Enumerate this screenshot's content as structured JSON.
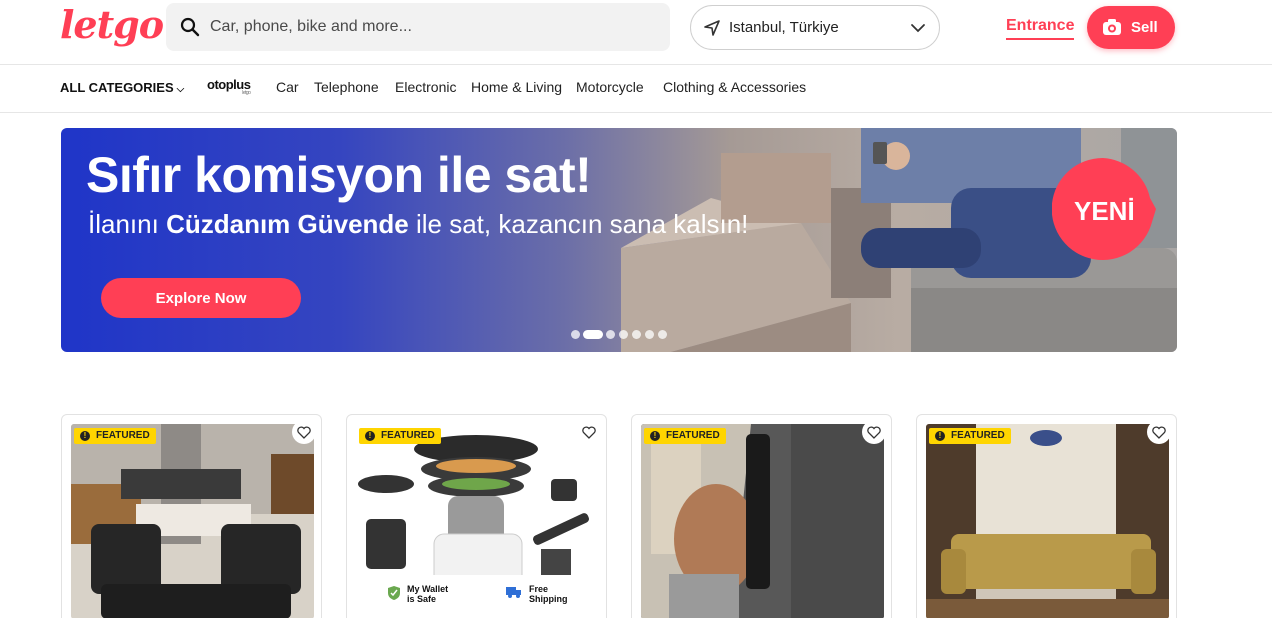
{
  "header": {
    "logo": "letgo",
    "search_placeholder": "Car, phone, bike and more...",
    "location": "Istanbul, Türkiye",
    "entrance": "Entrance",
    "sell": "Sell",
    "brand_color": "#ff3f55"
  },
  "categories": {
    "all_label": "ALL CATEGORIES",
    "otoplus": "otoplus",
    "otoplus_sub": "letgo",
    "items": [
      "Car",
      "Telephone",
      "Electronic",
      "Home & Living",
      "Motorcycle",
      "Clothing & Accessories"
    ]
  },
  "banner": {
    "title": "Sıfır komisyon ile sat!",
    "subtitle_pre": "İlanını ",
    "subtitle_bold": "Cüzdanım Güvende",
    "subtitle_post": " ile sat, kazancın sana kalsın!",
    "button": "Explore Now",
    "badge": "YENİ",
    "slides": 7,
    "active_slide": 2
  },
  "listings": [
    {
      "badge": "FEATURED",
      "image": "office-furniture-photo"
    },
    {
      "badge": "FEATURED",
      "image": "kitchen-robot-photo",
      "wallet_label": "My Wallet is Safe",
      "shipping_label": "Free Shipping"
    },
    {
      "badge": "FEATURED",
      "image": "phone-in-hand-photo"
    },
    {
      "badge": "FEATURED",
      "image": "sofa-photo"
    }
  ]
}
